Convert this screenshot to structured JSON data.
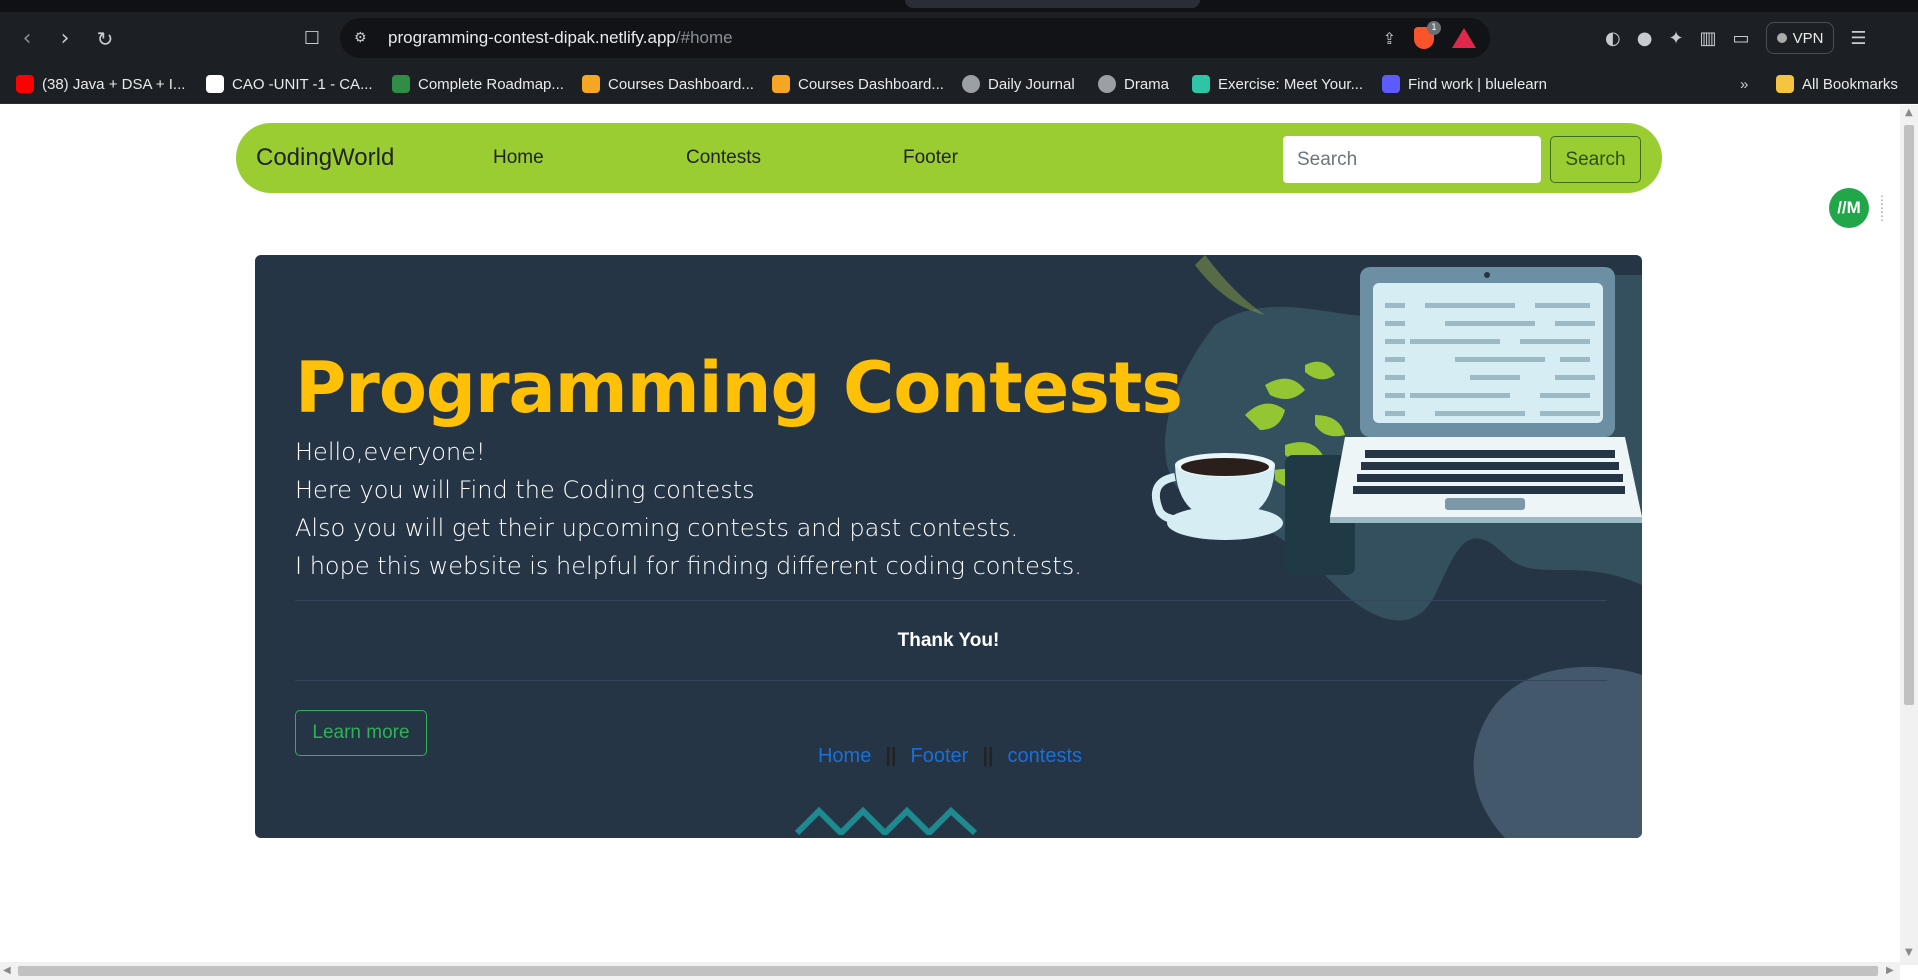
{
  "browser": {
    "url_host": "programming-contest-dipak.netlify.app",
    "url_path": "/#home",
    "vpn_label": "VPN",
    "shield_count": "1",
    "bookmarks": [
      {
        "label": "(38) Java + DSA + I...",
        "icon": "youtube-icon"
      },
      {
        "label": "CAO -UNIT -1 - CA...",
        "icon": "site-icon"
      },
      {
        "label": "Complete Roadmap...",
        "icon": "gfg-icon"
      },
      {
        "label": "Courses Dashboard...",
        "icon": "course-icon"
      },
      {
        "label": "Courses Dashboard...",
        "icon": "course-icon"
      },
      {
        "label": "Daily Journal",
        "icon": "globe-icon"
      },
      {
        "label": "Drama",
        "icon": "globe-icon"
      },
      {
        "label": "Exercise: Meet Your...",
        "icon": "layers-icon"
      },
      {
        "label": "Find work | bluelearn",
        "icon": "bl-icon"
      }
    ],
    "all_bookmarks_label": "All Bookmarks",
    "overflow_label": "»"
  },
  "nav": {
    "brand": "CodingWorld",
    "links": [
      "Home",
      "Contests",
      "Footer"
    ],
    "search_placeholder": "Search",
    "search_button": "Search",
    "bg_color": "#9acd32"
  },
  "hero": {
    "title": "Programming Contests",
    "lines": [
      "Hello,everyone!",
      "Here you will Find the Coding contests",
      "Also you will get their upcoming contests and past contests.",
      "I hope this website is helpful for finding different coding contests."
    ],
    "thanks": "Thank You!",
    "learn_more": "Learn more",
    "title_color": "#fec107",
    "bg_color": "#263545"
  },
  "footer": {
    "links": [
      "Home",
      "Footer",
      "contests"
    ],
    "separator": "||"
  },
  "extension_badge": "//M"
}
